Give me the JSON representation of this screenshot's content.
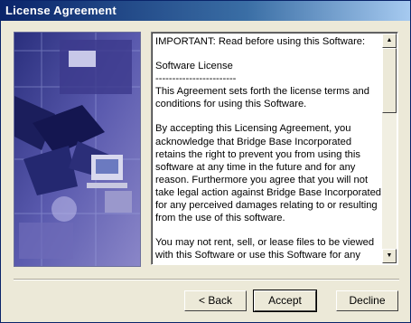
{
  "window": {
    "title": "License Agreement"
  },
  "license": {
    "paragraphs": [
      "IMPORTANT:  Read before using this Software:",
      "Software License\n------------------------\nThis Agreement sets forth the license terms and conditions for using this Software.",
      "By accepting this Licensing Agreement, you acknowledge that Bridge Base Incorporated retains the right to prevent you from using this software at any time in the future and for any reason. Furthermore you agree that you will not take legal action against Bridge Base Incorporated for any perceived damages relating to or resulting from the use of this software.",
      "You may not rent, sell, or lease files to be viewed with this Software or use this Software for any commercial purpose without the written consent of Bridge Base Incorporated. You may not make copies of any files"
    ]
  },
  "scrollbar": {
    "up_icon": "arrow-up-icon",
    "down_icon": "arrow-down-icon"
  },
  "buttons": {
    "back": "< Back",
    "accept": "Accept",
    "decline": "Decline"
  }
}
